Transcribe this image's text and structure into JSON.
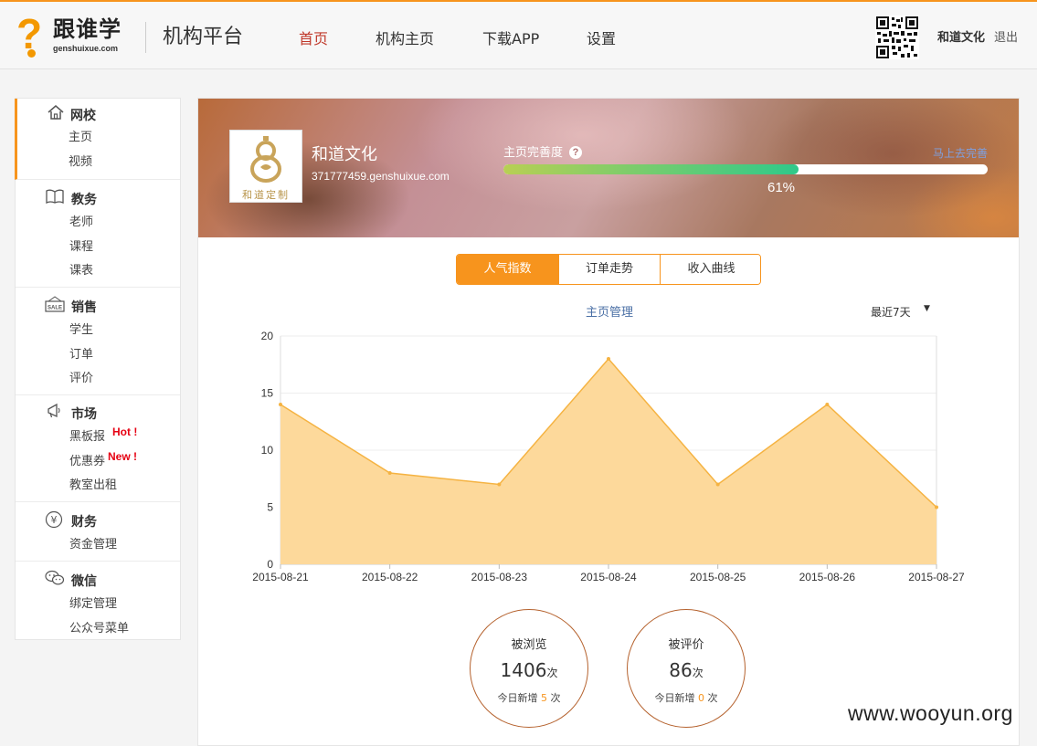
{
  "header": {
    "logo_text": "跟谁学",
    "logo_domain": "genshuixue.com",
    "platform_title": "机构平台",
    "nav": [
      {
        "label": "首页",
        "active": true
      },
      {
        "label": "机构主页",
        "active": false
      },
      {
        "label": "下载APP",
        "active": false
      },
      {
        "label": "设置",
        "active": false
      }
    ],
    "user_name": "和道文化",
    "logout_label": "退出"
  },
  "sidebar": {
    "groups": [
      {
        "title": "网校",
        "icon": "home-icon",
        "items": [
          {
            "label": "主页"
          },
          {
            "label": "视频"
          }
        ]
      },
      {
        "title": "教务",
        "icon": "book-icon",
        "items": [
          {
            "label": "老师"
          },
          {
            "label": "课程"
          },
          {
            "label": "课表"
          }
        ]
      },
      {
        "title": "销售",
        "icon": "sale-tag-icon",
        "items": [
          {
            "label": "学生"
          },
          {
            "label": "订单"
          },
          {
            "label": "评价"
          }
        ]
      },
      {
        "title": "市场",
        "icon": "megaphone-icon",
        "items": [
          {
            "label": "黑板报",
            "tag": "Hot !"
          },
          {
            "label": "优惠券",
            "tag": "New !"
          },
          {
            "label": "教室出租"
          }
        ]
      },
      {
        "title": "财务",
        "icon": "yen-icon",
        "items": [
          {
            "label": "资金管理"
          }
        ]
      },
      {
        "title": "微信",
        "icon": "wechat-icon",
        "items": [
          {
            "label": "绑定管理"
          },
          {
            "label": "公众号菜单"
          }
        ]
      }
    ]
  },
  "profile": {
    "logo_caption": "和道定制",
    "name": "和道文化",
    "domain": "371777459.genshuixue.com",
    "completeness_label": "主页完善度",
    "completeness_link": "马上去完善",
    "completeness_percent": 61,
    "completeness_text": "61%"
  },
  "tabs": [
    {
      "label": "人气指数",
      "active": true
    },
    {
      "label": "订单走势",
      "active": false
    },
    {
      "label": "收入曲线",
      "active": false
    }
  ],
  "chart_header": {
    "title": "主页管理",
    "range_selected": "最近7天"
  },
  "chart_data": {
    "type": "area",
    "title": "主页管理",
    "x": [
      "2015-08-21",
      "2015-08-22",
      "2015-08-23",
      "2015-08-24",
      "2015-08-25",
      "2015-08-26",
      "2015-08-27"
    ],
    "values": [
      14,
      8,
      7,
      18,
      7,
      14,
      5
    ],
    "ylim": [
      0,
      20
    ],
    "yticks": [
      0,
      5,
      10,
      15,
      20
    ],
    "grid": true,
    "fill_color": "#fdd99b",
    "line_color": "#f5b342"
  },
  "stats": [
    {
      "label": "被浏览",
      "value": "1406",
      "unit": "次",
      "today_prefix": "今日新增",
      "today_value": "5",
      "today_unit": "次"
    },
    {
      "label": "被评价",
      "value": "86",
      "unit": "次",
      "today_prefix": "今日新增",
      "today_value": "0",
      "today_unit": "次"
    }
  ],
  "watermark": "www.wooyun.org",
  "colors": {
    "accent": "#f7941d",
    "active_nav": "#c0392b",
    "link": "#4a6fa5"
  }
}
